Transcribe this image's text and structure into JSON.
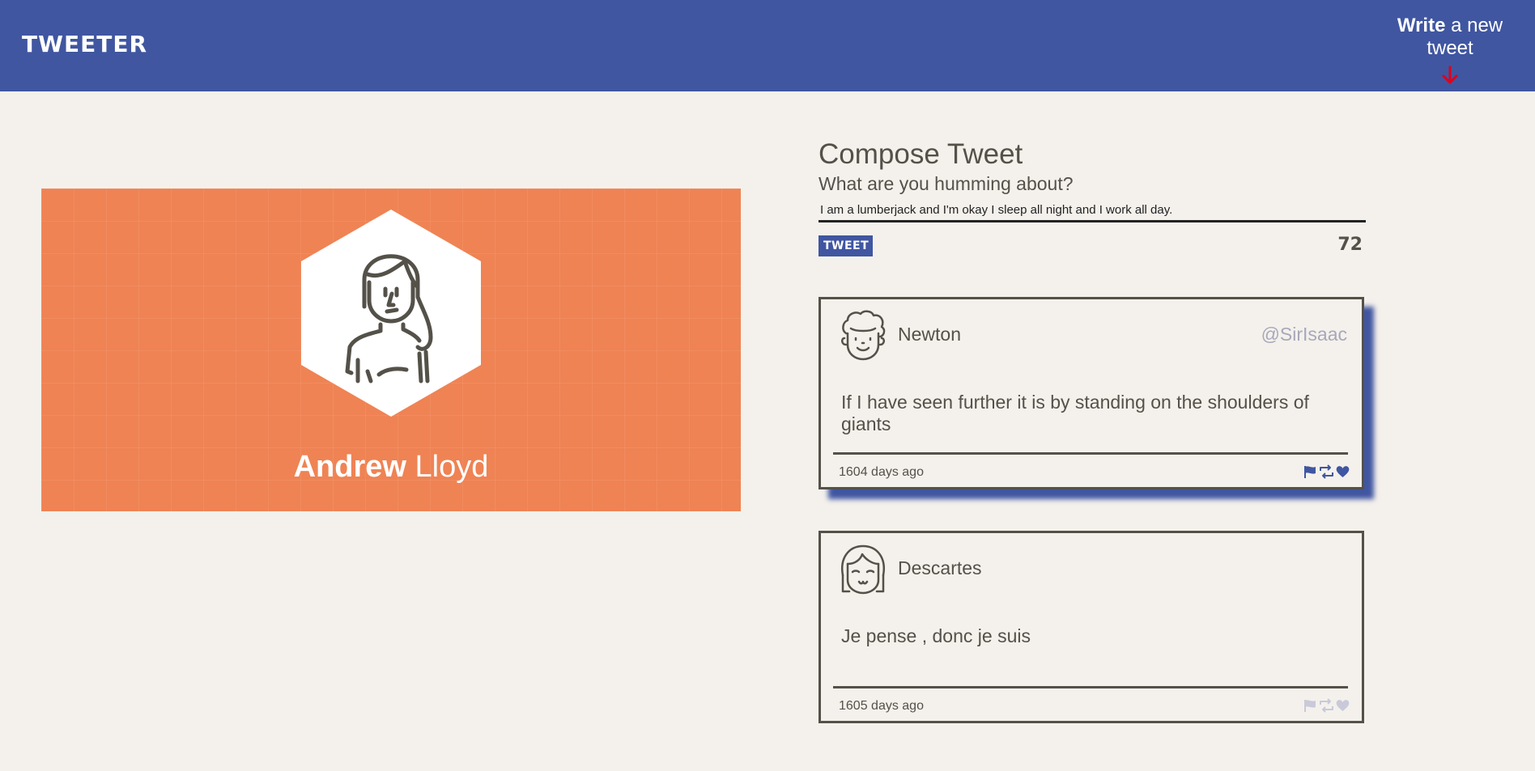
{
  "nav": {
    "brand": "TWEETER",
    "compose_toggle": {
      "strong": "Write",
      "rest": " a new tweet",
      "arrow_icon": "arrow-down-icon"
    }
  },
  "profile": {
    "first_name": "Andrew",
    "last_name": "Lloyd",
    "avatar_icon": "woman-avatar-icon",
    "background_color": "#ef8354"
  },
  "compose": {
    "title": "Compose Tweet",
    "label": "What are you humming about?",
    "input_value": "I am a lumberjack and I'm okay I sleep all night and I work all day.",
    "button_label": "TWEET",
    "counter": "72"
  },
  "tweets": [
    {
      "author": "Newton",
      "handle": "@SirIsaac",
      "avatar_icon": "curly-hair-man-avatar-icon",
      "content": "If I have seen further it is by standing on the shoulders of giants",
      "time": "1604 days ago",
      "actions_active": true
    },
    {
      "author": "Descartes",
      "handle": "",
      "avatar_icon": "bangs-girl-avatar-icon",
      "content": "Je pense , donc je suis",
      "time": "1605 days ago",
      "actions_active": false
    }
  ],
  "colors": {
    "nav_bg": "#4056a1",
    "page_bg": "#f4f1ec",
    "text": "#545149",
    "accent_arrow": "#e0001b",
    "action_active": "#4056a1",
    "action_inactive": "#c9c9d9"
  }
}
